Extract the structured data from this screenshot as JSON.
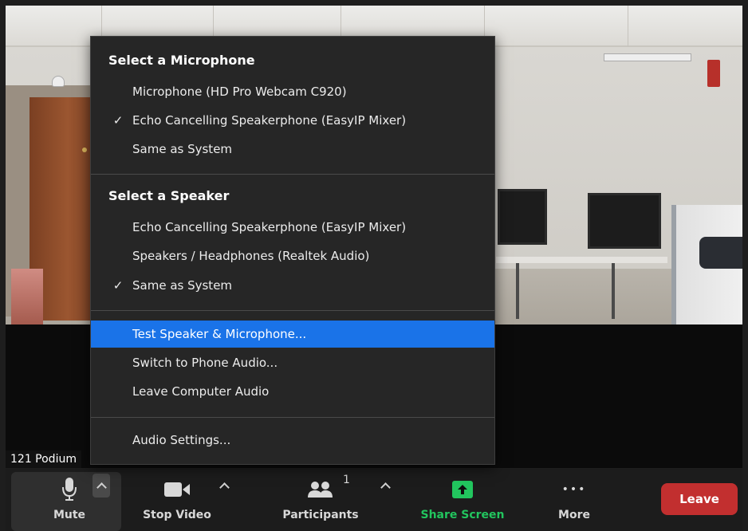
{
  "video": {
    "participant_name": "121 Podium"
  },
  "audio_menu": {
    "microphone_header": "Select a Microphone",
    "microphones": [
      {
        "label": "Microphone (HD Pro Webcam C920)",
        "checked": false
      },
      {
        "label": "Echo Cancelling Speakerphone (EasyIP Mixer)",
        "checked": true
      },
      {
        "label": "Same as System",
        "checked": false
      }
    ],
    "speaker_header": "Select a Speaker",
    "speakers": [
      {
        "label": "Echo Cancelling Speakerphone (EasyIP Mixer)",
        "checked": false
      },
      {
        "label": "Speakers / Headphones (Realtek Audio)",
        "checked": false
      },
      {
        "label": "Same as System",
        "checked": true
      }
    ],
    "actions": [
      {
        "label": "Test Speaker & Microphone...",
        "highlighted": true
      },
      {
        "label": "Switch to Phone Audio...",
        "highlighted": false
      },
      {
        "label": "Leave Computer Audio",
        "highlighted": false
      }
    ],
    "settings_label": "Audio Settings...",
    "check_glyph": "✓"
  },
  "toolbar": {
    "mute_label": "Mute",
    "stop_video_label": "Stop Video",
    "participants_label": "Participants",
    "participants_count": "1",
    "share_screen_label": "Share Screen",
    "more_label": "More",
    "more_glyph": "•••",
    "leave_label": "Leave"
  },
  "colors": {
    "highlight": "#1a73e8",
    "share_green": "#22c55e",
    "leave_red": "#c22f2f",
    "menu_bg": "#262626",
    "toolbar_bg": "#1c1c1c"
  },
  "icons": {
    "mic": "microphone-icon",
    "video": "video-camera-icon",
    "participants": "participants-icon",
    "share": "share-screen-arrow-icon",
    "more": "more-dots-icon",
    "caret": "chevron-up-icon",
    "check": "checkmark-icon"
  }
}
